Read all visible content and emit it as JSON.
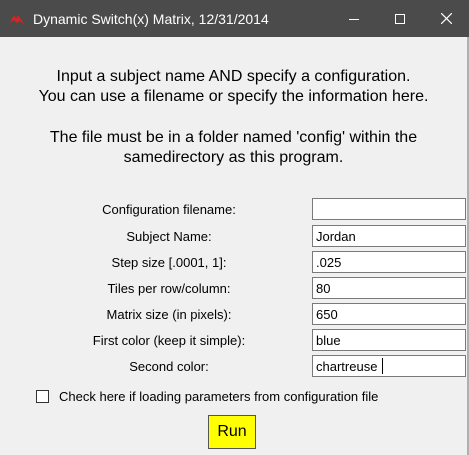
{
  "window": {
    "title": "Dynamic Switch(x) Matrix, 12/31/2014",
    "app_icon": "tk-feather-icon",
    "controls": [
      "minimize-icon",
      "maximize-icon",
      "close-icon"
    ]
  },
  "instructions": {
    "line1": "Input a subject name AND specify a configuration.",
    "line2": "You can use a filename or specify the information here.",
    "line3": "The file must be in a folder named 'config' within the",
    "line4": "samedirectory as this program."
  },
  "form": {
    "fields": [
      {
        "label": "Configuration filename:",
        "value": ""
      },
      {
        "label": "Subject Name:",
        "value": "Jordan"
      },
      {
        "label": "Step size [.0001, 1]:",
        "value": ".025"
      },
      {
        "label": "Tiles per row/column:",
        "value": "80"
      },
      {
        "label": "Matrix size (in pixels):",
        "value": "650"
      },
      {
        "label": "First color (keep it simple):",
        "value": "blue"
      },
      {
        "label": "Second color:",
        "value": "chartreuse"
      }
    ]
  },
  "checkbox": {
    "label": "Check here if loading parameters from configuration file",
    "checked": false
  },
  "run_button": {
    "label": "Run",
    "color": "#ffff00"
  }
}
